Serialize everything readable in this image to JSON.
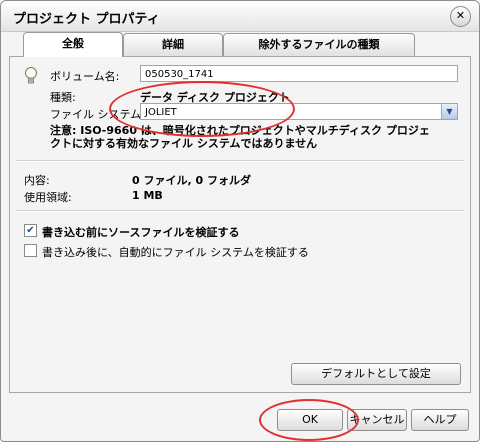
{
  "window": {
    "title": "プロジェクト プロパティ",
    "close_glyph": "✕"
  },
  "tabs": [
    {
      "label": "全般"
    },
    {
      "label": "詳細"
    },
    {
      "label": "除外するファイルの種類"
    }
  ],
  "general": {
    "volume_label": "ボリューム名:",
    "volume_value": "050530_1741",
    "type_label": "種類:",
    "type_value": "データ ディスク プロジェクト",
    "fs_label": "ファイル システム:",
    "fs_value": "JOLIET",
    "notice": "注意: ISO-9660 は、暗号化されたプロジェクトやマルチディスク プロジェクトに対する有効なファイル システムではありません",
    "contents_label": "内容:",
    "contents_value": "0 ファイル, 0 フォルダ",
    "used_label": "使用領域:",
    "used_value": "1 MB",
    "checkbox1": {
      "label": "書き込む前にソースファイルを検証する",
      "checked": true
    },
    "checkbox2": {
      "label": "書き込み後に、自動的にファイル システムを検証する",
      "checked": false
    },
    "default_button": "デフォルトとして設定"
  },
  "footer": {
    "ok": "OK",
    "cancel": "キャンセル",
    "help": "ヘルプ"
  },
  "icons": {
    "bulb": "lightbulb-icon",
    "checkmark": "✔",
    "dropdown": "▼"
  },
  "colors": {
    "annotation_red": "#e03030",
    "check_blue": "#1b4aa8"
  }
}
